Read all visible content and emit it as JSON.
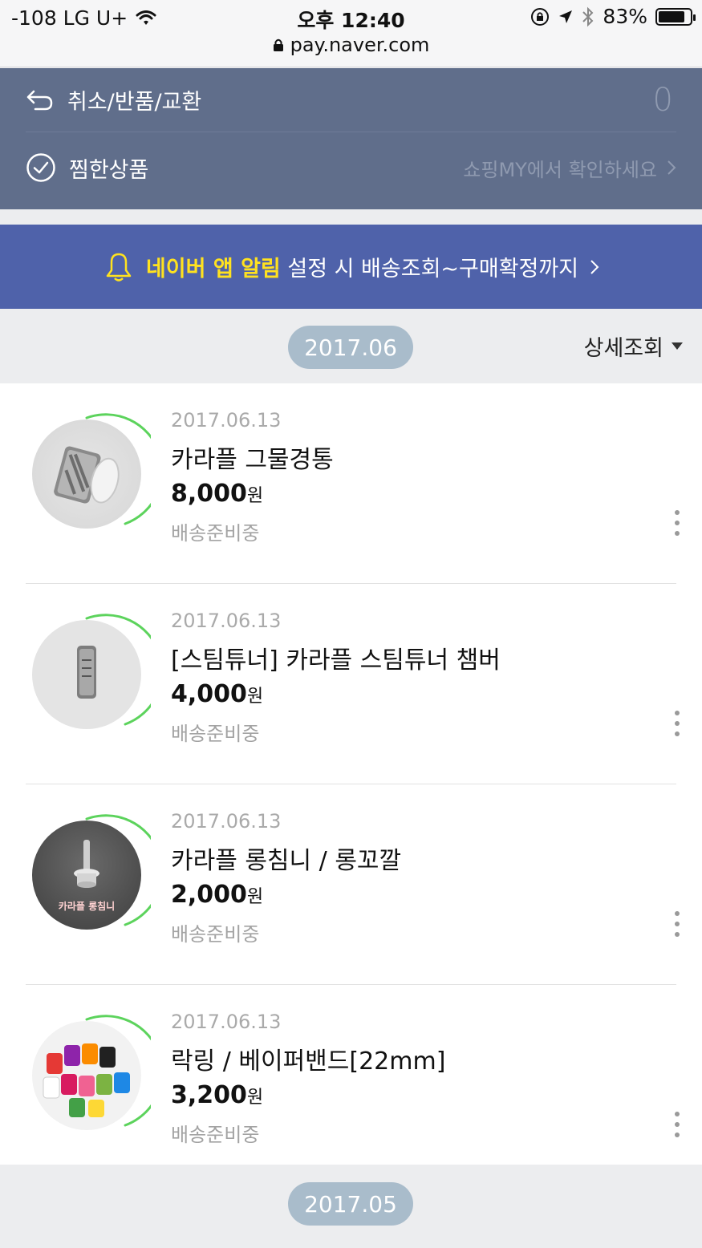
{
  "status_bar": {
    "carrier": "-108 LG U+",
    "time": "오후 12:40",
    "battery": "83%",
    "battery_level": 0.83,
    "url": "pay.naver.com"
  },
  "menu": {
    "cancel_label": "취소/반품/교환",
    "cancel_count": "0",
    "wishlist_label": "찜한상품",
    "wishlist_hint": "쇼핑MY에서 확인하세요"
  },
  "banner": {
    "highlight": "네이버 앱 알림",
    "text": "설정 시 배송조회~구매확정까지"
  },
  "filter": {
    "detail_label": "상세조회"
  },
  "months": [
    {
      "label": "2017.06"
    },
    {
      "label": "2017.05"
    }
  ],
  "orders": [
    {
      "date": "2017.06.13",
      "name": "카라플 그물경통",
      "price": "8,000",
      "currency": "원",
      "status": "배송준비중"
    },
    {
      "date": "2017.06.13",
      "name": "[스팀튜너] 카라플 스팀튜너 챔버",
      "price": "4,000",
      "currency": "원",
      "status": "배송준비중"
    },
    {
      "date": "2017.06.13",
      "name": "카라플 롱침니 / 롱꼬깔",
      "price": "2,000",
      "currency": "원",
      "status": "배송준비중",
      "image_caption": "카라플 롱침니"
    },
    {
      "date": "2017.06.13",
      "name": "락링 / 베이퍼밴드[22mm]",
      "price": "3,200",
      "currency": "원",
      "status": "배송준비중"
    }
  ],
  "colors": {
    "menu_bg": "#606e8b",
    "banner_bg": "#4f62aa",
    "banner_highlight": "#ffe21f",
    "month_pill": "#a9bccb",
    "progress_ring": "#5cd35c"
  }
}
